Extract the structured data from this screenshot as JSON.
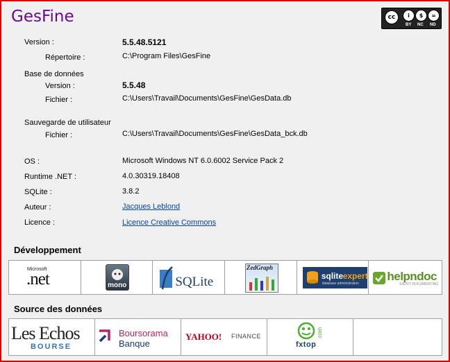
{
  "app": {
    "title": "GesFine"
  },
  "license_badge": {
    "by": "BY",
    "nc": "NC",
    "nd": "ND"
  },
  "info": {
    "version_label": "Version :",
    "version_value": "5.5.48.5121",
    "directory_label": "Répertoire :",
    "directory_value": "C:\\Program Files\\GesFine",
    "database_label": "Base de données",
    "db_version_label": "Version :",
    "db_version_value": "5.5.48",
    "db_file_label": "Fichier :",
    "db_file_value": "C:\\Users\\Travail\\Documents\\GesFine\\GesData.db",
    "backup_label": "Sauvegarde de utilisateur",
    "backup_file_label": "Fichier :",
    "backup_file_value": "C:\\Users\\Travail\\Documents\\GesFine\\GesData_bck.db",
    "os_label": "OS :",
    "os_value": "Microsoft Windows NT 6.0.6002 Service Pack 2",
    "runtime_label": "Runtime .NET :",
    "runtime_value": "4.0.30319.18408",
    "sqlite_label": "SQLite :",
    "sqlite_value": "3.8.2",
    "author_label": "Auteur :",
    "author_value": "Jacques Leblond",
    "licence_label": "Licence :",
    "licence_value": "Licence Creative Commons"
  },
  "development": {
    "title": "Développement",
    "logos": {
      "dotnet_top": "Microsoft",
      "dotnet_main": ".net",
      "mono": "mono",
      "sqlite": "SQLite",
      "zedgraph": "ZedGraph",
      "sqliteexpert_a": "sqlite",
      "sqliteexpert_b": "expert",
      "sqliteexpert_sub": "database administration",
      "helpndoc": "helpndoc",
      "helpndoc_sub": "ENJOY DOCUMENTING"
    }
  },
  "sources": {
    "title": "Source des données",
    "logos": {
      "lesechos_main": "Les Echos",
      "lesechos_sub": "BOURSE",
      "boursorama_a": "Boursorama",
      "boursorama_b": "Banque",
      "yahoo_main": "YAHOO!",
      "yahoo_sub": "FINANCE",
      "fxtop_main": "fxtop",
      "fxtop_side": ".com"
    }
  },
  "colors": {
    "title": "#6a0a8c",
    "frame": "#e00000",
    "link": "#0645ad"
  }
}
